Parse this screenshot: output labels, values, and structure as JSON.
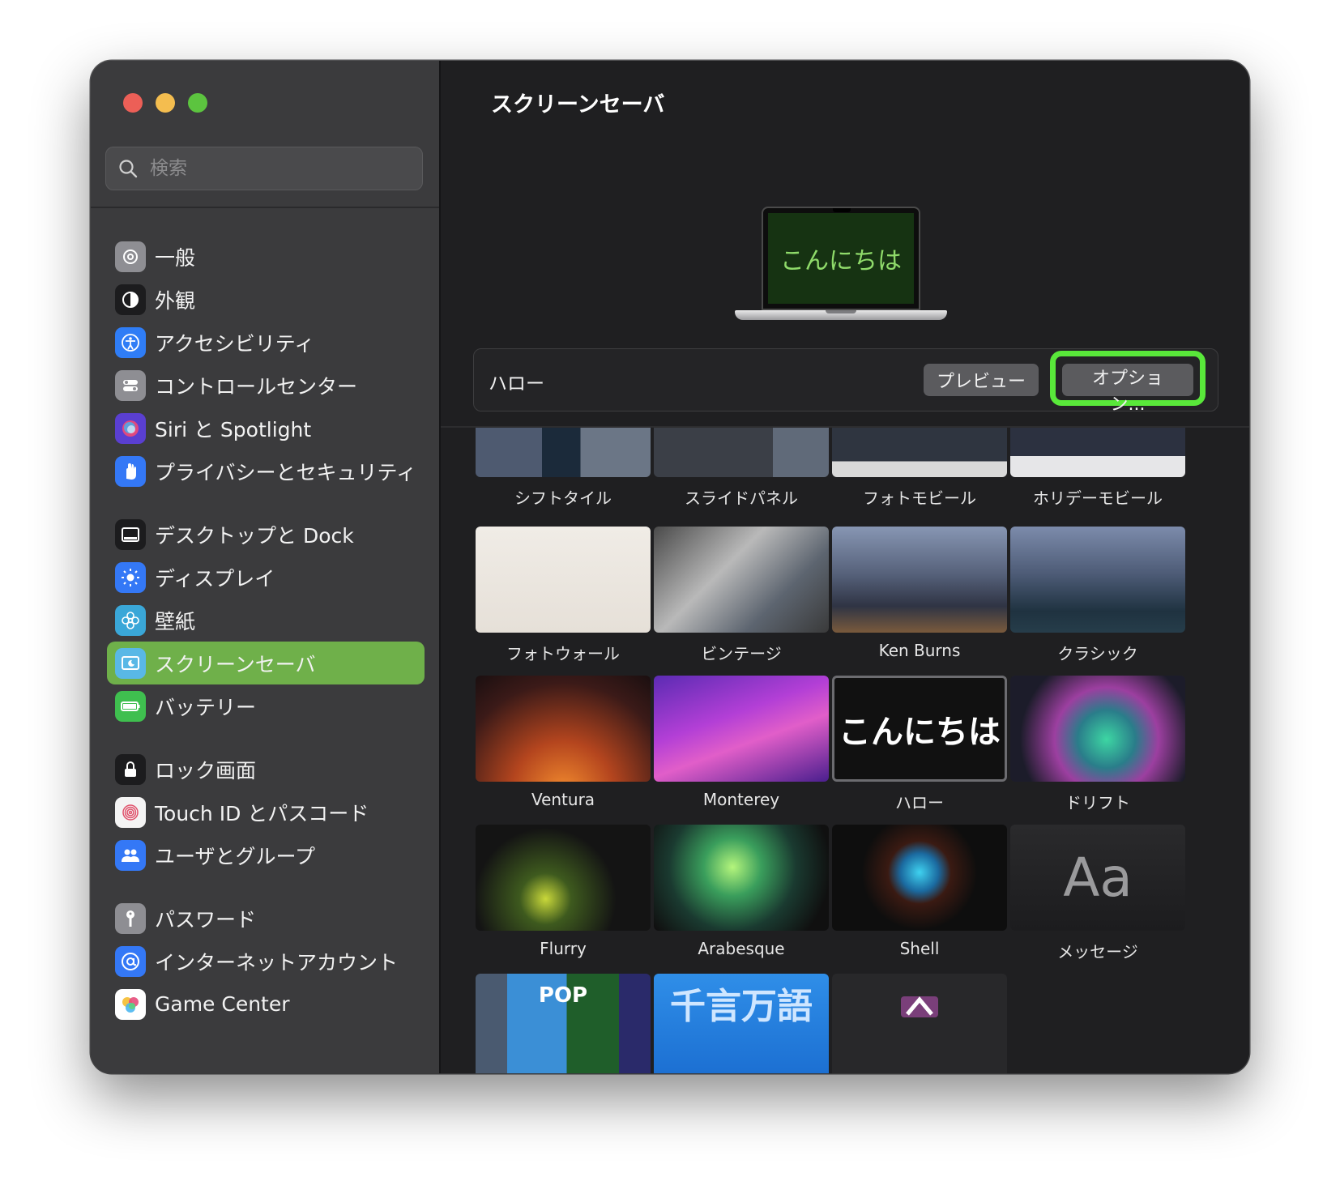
{
  "window": {
    "traffic_lights": [
      "close",
      "minimize",
      "zoom"
    ]
  },
  "search": {
    "placeholder": "検索"
  },
  "sidebar": {
    "items": [
      {
        "label": "一般",
        "icon": "gear-icon",
        "color": "#8e8e93",
        "group": 1
      },
      {
        "label": "外観",
        "icon": "appearance-icon",
        "color": "#1c1c1e",
        "group": 1
      },
      {
        "label": "アクセシビリティ",
        "icon": "accessibility-icon",
        "color": "#2f7df6",
        "group": 1
      },
      {
        "label": "コントロールセンター",
        "icon": "control-center-icon",
        "color": "#8e8e93",
        "group": 1
      },
      {
        "label": "Siri と Spotlight",
        "icon": "siri-icon",
        "color": "#5a3fd1",
        "group": 1
      },
      {
        "label": "プライバシーとセキュリティ",
        "icon": "hand-icon",
        "color": "#3478f6",
        "group": 1
      },
      {
        "label": "デスクトップと Dock",
        "icon": "dock-icon",
        "color": "#1c1c1e",
        "group": 2
      },
      {
        "label": "ディスプレイ",
        "icon": "display-brightness-icon",
        "color": "#3478f6",
        "group": 2
      },
      {
        "label": "壁紙",
        "icon": "wallpaper-flower-icon",
        "color": "#3aa7d8",
        "group": 2
      },
      {
        "label": "スクリーンセーバ",
        "icon": "screensaver-icon",
        "color": "#59b8e6",
        "group": 2,
        "active": true
      },
      {
        "label": "バッテリー",
        "icon": "battery-icon",
        "color": "#3fbf4f",
        "group": 2
      },
      {
        "label": "ロック画面",
        "icon": "lock-icon",
        "color": "#1c1c1e",
        "group": 3
      },
      {
        "label": "Touch ID とパスコード",
        "icon": "fingerprint-icon",
        "color": "#f4f4f4",
        "group": 3
      },
      {
        "label": "ユーザとグループ",
        "icon": "users-icon",
        "color": "#3478f6",
        "group": 3
      },
      {
        "label": "パスワード",
        "icon": "key-icon",
        "color": "#8e8e93",
        "group": 4
      },
      {
        "label": "インターネットアカウント",
        "icon": "at-icon",
        "color": "#3478f6",
        "group": 4
      },
      {
        "label": "Game Center",
        "icon": "game-center-icon",
        "color": "#ffffff",
        "group": 4
      }
    ]
  },
  "main": {
    "title": "スクリーンセーバ",
    "preview_screen_text": "こんにちは",
    "selected_name": "ハロー",
    "preview_button": "プレビュー",
    "options_button": "オプション...",
    "accent_highlight": "#59e83a"
  },
  "savers": [
    {
      "label": "シフトタイル",
      "style": "shift",
      "partial": "top"
    },
    {
      "label": "スライドパネル",
      "style": "slide",
      "partial": "top"
    },
    {
      "label": "フォトモビール",
      "style": "mobile",
      "partial": "top"
    },
    {
      "label": "ホリデーモビール",
      "style": "holiday",
      "partial": "top"
    },
    {
      "label": "フォトウォール",
      "style": "wall"
    },
    {
      "label": "ビンテージ",
      "style": "vintage"
    },
    {
      "label": "Ken Burns",
      "style": "kenburns"
    },
    {
      "label": "クラシック",
      "style": "classic"
    },
    {
      "label": "Ventura",
      "style": "ventura"
    },
    {
      "label": "Monterey",
      "style": "monterey"
    },
    {
      "label": "ハロー",
      "style": "hello",
      "text": "こんにちは",
      "selected": true
    },
    {
      "label": "ドリフト",
      "style": "drift"
    },
    {
      "label": "Flurry",
      "style": "flurry"
    },
    {
      "label": "Arabesque",
      "style": "arabesque"
    },
    {
      "label": "Shell",
      "style": "shell"
    },
    {
      "label": "メッセージ",
      "style": "message",
      "text": "Aa"
    },
    {
      "label": "",
      "style": "album",
      "partial": "bottom",
      "text": "POP"
    },
    {
      "label": "",
      "style": "word",
      "partial": "bottom",
      "text": "千言万語"
    },
    {
      "label": "",
      "style": "random",
      "partial": "bottom"
    }
  ]
}
